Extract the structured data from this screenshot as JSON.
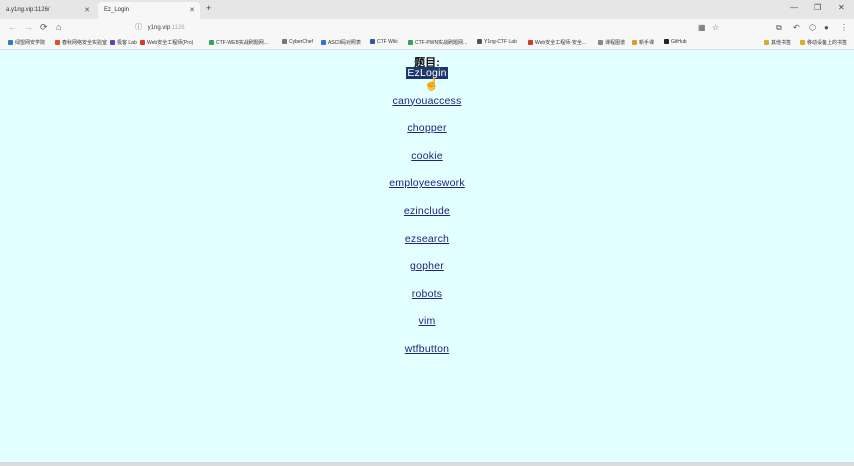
{
  "tabs": [
    {
      "label": "a.y1ng.vip:1126/"
    },
    {
      "label": "Ez_Login"
    }
  ],
  "window_controls": {
    "minimize": "—",
    "restore": "❐",
    "close": "✕"
  },
  "nav": {
    "back": "←",
    "forward": "→",
    "reload": "⟳",
    "home": "⌂",
    "address_main": "y1ng.vip",
    "address_rest": ":1126"
  },
  "bookmarks": [
    {
      "label": "绿盟网安学院",
      "color": "#2a7bd4"
    },
    {
      "label": "春秋网络安全实验室",
      "color": "#e0502a"
    },
    {
      "label": "极客 Lab",
      "color": "#6a3fb5"
    },
    {
      "label": "Web安全工程师(Pro)",
      "color": "#d43a2a"
    },
    {
      "label": "CTF-WEB实战刷题网...",
      "color": "#3aa05a"
    },
    {
      "label": "CyberChef",
      "color": "#777777"
    },
    {
      "label": "ASCII码对照表",
      "color": "#3a6fd4"
    },
    {
      "label": "CTF Wiki",
      "color": "#2a5a9a"
    },
    {
      "label": "CTF-PWN实战刷题网...",
      "color": "#3aa05a"
    },
    {
      "label": "Y1ng-CTF Lab",
      "color": "#555555"
    },
    {
      "label": "Web安全工程师-安全...",
      "color": "#d43a2a"
    },
    {
      "label": "课程图谱",
      "color": "#888888"
    },
    {
      "label": "新手课",
      "color": "#d4a02a"
    },
    {
      "label": "GitHub",
      "color": "#222222"
    },
    {
      "label": "其他书签",
      "color": "#d4b02a"
    },
    {
      "label": "移动设备上的书签",
      "color": "#d4b02a"
    }
  ],
  "page": {
    "heading": "题目:",
    "links": [
      "EzLogin",
      "canyouaccess",
      "chopper",
      "cookie",
      "employeeswork",
      "ezinclude",
      "ezsearch",
      "gopher",
      "robots",
      "vim",
      "wtfbutton"
    ],
    "selected_index": 0
  }
}
